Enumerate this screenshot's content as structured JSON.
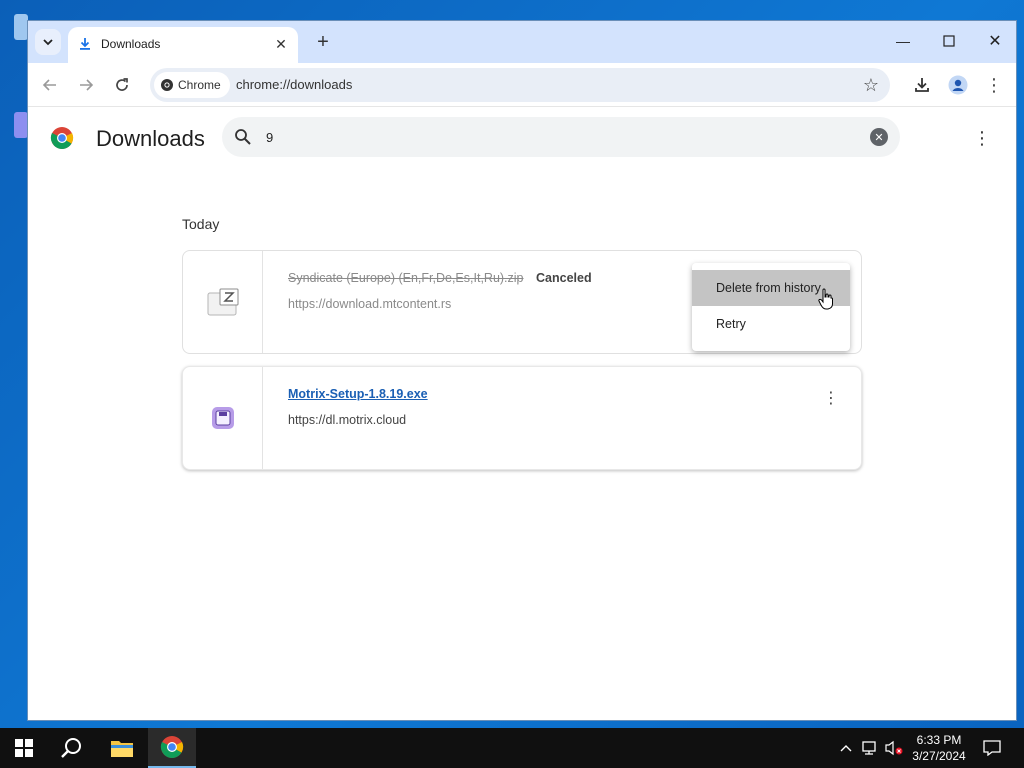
{
  "browser": {
    "tab": {
      "title": "Downloads",
      "icon": "download-icon"
    },
    "toolbar": {
      "site_chip": "Chrome",
      "url": "chrome://downloads"
    }
  },
  "page": {
    "title": "Downloads",
    "search": {
      "value": "9",
      "placeholder": "Search downloads"
    },
    "section_label": "Today",
    "downloads": [
      {
        "filename": "Syndicate (Europe) (En,Fr,De,Es,It,Ru).zip",
        "status": "Canceled",
        "source": "https://download.mtcontent.rs",
        "canceled": true
      },
      {
        "filename": "Motrix-Setup-1.8.19.exe",
        "status": "",
        "source": "https://dl.motrix.cloud",
        "canceled": false
      }
    ],
    "context_menu": {
      "items": [
        "Delete from history",
        "Retry"
      ],
      "hovered": "Delete from history"
    }
  },
  "taskbar": {
    "time": "6:33 PM",
    "date": "3/27/2024"
  },
  "colors": {
    "accent": "#1a73e8",
    "link": "#1a5fb4",
    "titlebar": "#d3e3fd",
    "taskbar": "#101010"
  }
}
